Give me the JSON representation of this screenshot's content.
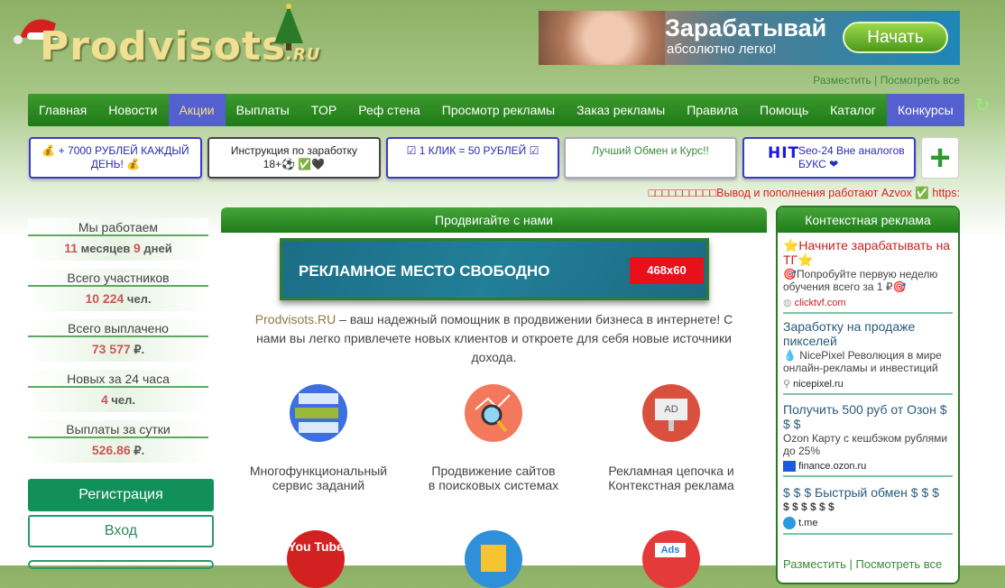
{
  "logo": {
    "text": "Prodvisots",
    "tld": ".RU"
  },
  "top_ad": {
    "title": "Зарабатывай",
    "subtitle": "абсолютно легко!",
    "button": "Начать"
  },
  "top_links": {
    "place": "Разместить",
    "sep": " | ",
    "view_all": "Посмотреть все"
  },
  "nav": [
    "Главная",
    "Новости",
    "Акции",
    "Выплаты",
    "TOP",
    "Реф стена",
    "Просмотр рекламы",
    "Заказ рекламы",
    "Правила",
    "Помощь",
    "Каталог",
    "Конкурсы"
  ],
  "link_buttons": [
    "💰 + 7000 РУБЛЕЙ КАЖДЫЙ ДЕНЬ! 💰",
    "Инструкция по заработку 18+⚽ ✅🖤",
    "☑ 1 КЛИК = 50 РУБЛЕЙ ☑",
    "Лучший Обмен и Курс!!",
    "Seo-24 Вне аналогов БУКС ❤"
  ],
  "hit_badge": "HIT",
  "marquee": "□□□□□□□□□□Вывод и пополнения работают Azvox ✅ https:",
  "stats": [
    {
      "title": "Мы работаем",
      "v1": "11",
      "u1": " месяцев ",
      "v2": "9",
      "u2": " дней"
    },
    {
      "title": "Всего участников",
      "v1": "10 224",
      "u1": " чел.",
      "v2": "",
      "u2": ""
    },
    {
      "title": "Всего выплачено",
      "v1": "73 577",
      "u1": " ₽.",
      "v2": "",
      "u2": ""
    },
    {
      "title": "Новых за 24 часа",
      "v1": "4",
      "u1": " чел.",
      "v2": "",
      "u2": ""
    },
    {
      "title": "Выплаты за сутки",
      "v1": "526.86",
      "u1": " ₽.",
      "v2": "",
      "u2": ""
    }
  ],
  "auth": {
    "register": "Регистрация",
    "login": "Вход"
  },
  "center": {
    "header": "Продвигайте с нами",
    "ad_text": "РЕКЛАМНОЕ  МЕСТО СВОБОДНО",
    "ad_size": "468x60",
    "intro_brand": "Prodvisots.RU",
    "intro_text": " – ваш надежный помощник в продвижении бизнеса в интернете! С нами вы легко привлечете новых клиентов и откроете для себя новые источники дохода.",
    "features": [
      {
        "line1": "Многофункциональный",
        "line2": "сервис заданий",
        "color": "#3d6fe0"
      },
      {
        "line1": "Продвижение сайтов",
        "line2": "в поисковых системах",
        "color": "#f4795c"
      },
      {
        "line1": "Рекламная цепочка и",
        "line2": "Контекстная реклама",
        "color": "#d9503f"
      }
    ],
    "features2": [
      {
        "label": "You Tube",
        "color": "#d32020"
      },
      {
        "label": "",
        "color": "#2f8fd8"
      },
      {
        "label": "Ads",
        "color": "#e53a3a"
      }
    ]
  },
  "context": {
    "header": "Контекстная реклама",
    "items": [
      {
        "title": "⭐Начните зарабатывать на ТГ⭐",
        "desc": "🎯Попробуйте первую неделю обучения всего за 1 ₽🎯",
        "url": "clicktvf.com",
        "icon": "globe-icon"
      },
      {
        "title": "Заработку на продаже пикселей",
        "desc": "💧 NicePixel Революция в мире онлайн-рекламы и инвестиций",
        "url": "nicepixel.ru",
        "icon": "pixel-icon"
      },
      {
        "title": "Получить 500 руб от Озон $ $ $",
        "desc": "Ozon Карту с кешбэком рублями до 25%",
        "url": "finance.ozon.ru",
        "icon": "ozon-icon"
      },
      {
        "title": "$ $ $ Быстрый обмен $ $ $",
        "desc": "$ $ $ $ $ $",
        "url": "t.me",
        "icon": "telegram-icon"
      }
    ],
    "place": "Разместить",
    "view_all": "Посмотреть все"
  }
}
